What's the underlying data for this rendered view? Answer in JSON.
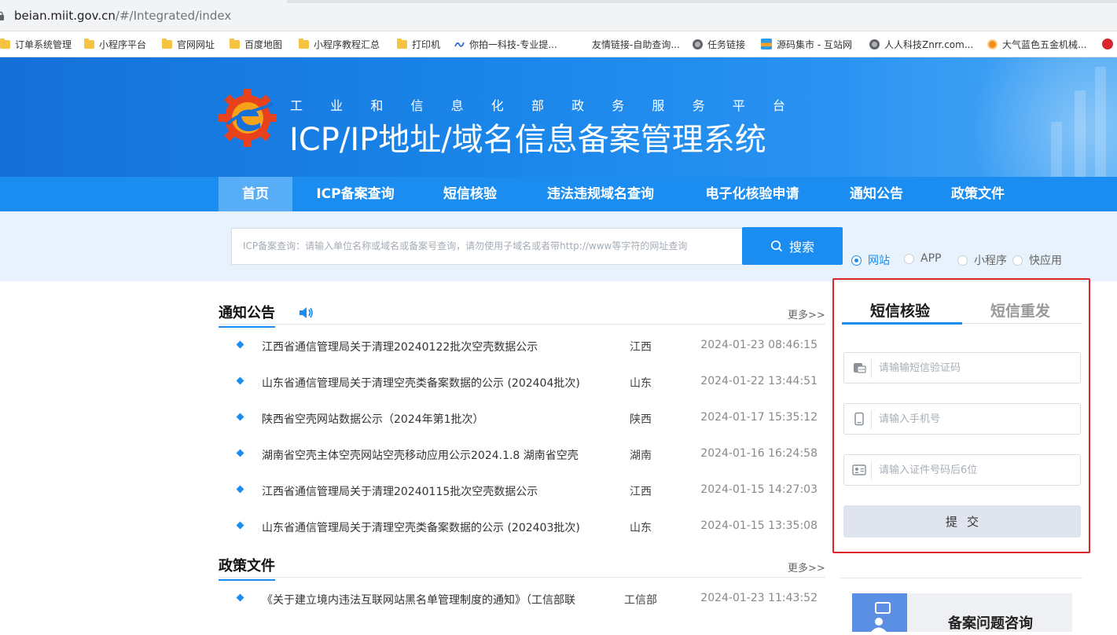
{
  "browser": {
    "url_host": "beian.miit.gov.cn",
    "url_path": "/#/Integrated/index"
  },
  "bookmarks": [
    {
      "label": "订单系统管理",
      "icon": "folder-icon"
    },
    {
      "label": "小程序平台",
      "icon": "folder-icon"
    },
    {
      "label": "官网网址",
      "icon": "folder-icon"
    },
    {
      "label": "百度地图",
      "icon": "folder-icon"
    },
    {
      "label": "小程序教程汇总",
      "icon": "folder-icon"
    },
    {
      "label": "打印机",
      "icon": "folder-icon"
    },
    {
      "label": "你拍一科技-专业提...",
      "icon": "wave-icon"
    },
    {
      "label": "友情链接-自助查询...",
      "icon": "none"
    },
    {
      "label": "任务链接",
      "icon": "globe-icon"
    },
    {
      "label": "源码集市 - 互站网",
      "icon": "source-icon"
    },
    {
      "label": "人人科技Znrr.com...",
      "icon": "globe-icon"
    },
    {
      "label": "大气蓝色五金机械...",
      "icon": "orange-icon"
    }
  ],
  "banner": {
    "subtitle_chars": [
      "工",
      "业",
      "和",
      "信",
      "息",
      "化",
      "部",
      "政",
      "务",
      "服",
      "务",
      "平",
      "台"
    ],
    "title": "ICP/IP地址/域名信息备案管理系统"
  },
  "nav": [
    {
      "label": "首页",
      "active": true
    },
    {
      "label": "ICP备案查询",
      "active": false
    },
    {
      "label": "短信核验",
      "active": false
    },
    {
      "label": "违法违规域名查询",
      "active": false
    },
    {
      "label": "电子化核验申请",
      "active": false
    },
    {
      "label": "通知公告",
      "active": false
    },
    {
      "label": "政策文件",
      "active": false
    }
  ],
  "search": {
    "placeholder": "ICP备案查询：请输入单位名称或域名或备案号查询，请勿使用子域名或者带http://www等字符的网址查询",
    "button_label": "搜索",
    "options": [
      {
        "label": "网站",
        "checked": true
      },
      {
        "label": "APP",
        "checked": false
      },
      {
        "label": "小程序",
        "checked": false
      },
      {
        "label": "快应用",
        "checked": false
      }
    ]
  },
  "notices": {
    "title": "通知公告",
    "more": "更多>>",
    "rows": [
      {
        "title": "江西省通信管理局关于清理20240122批次空壳数据公示",
        "region": "江西",
        "date": "2024-01-23 08:46:15"
      },
      {
        "title": "山东省通信管理局关于清理空壳类备案数据的公示 (202404批次)",
        "region": "山东",
        "date": "2024-01-22 13:44:51"
      },
      {
        "title": "陕西省空壳网站数据公示（2024年第1批次）",
        "region": "陕西",
        "date": "2024-01-17 15:35:12"
      },
      {
        "title": "湖南省空壳主体空壳网站空壳移动应用公示2024.1.8 湖南省空壳",
        "region": "湖南",
        "date": "2024-01-16 16:24:58"
      },
      {
        "title": "江西省通信管理局关于清理20240115批次空壳数据公示",
        "region": "江西",
        "date": "2024-01-15 14:27:03"
      },
      {
        "title": "山东省通信管理局关于清理空壳类备案数据的公示 (202403批次)",
        "region": "山东",
        "date": "2024-01-15 13:35:08"
      }
    ]
  },
  "policies": {
    "title": "政策文件",
    "more": "更多>>",
    "rows": [
      {
        "title": "《关于建立境内违法互联网站黑名单管理制度的通知》（工信部联",
        "region": "工信部",
        "date": "2024-01-23 11:43:52"
      }
    ]
  },
  "sms": {
    "tab_verify": "短信核验",
    "tab_resend": "短信重发",
    "code_placeholder": "请输输短信验证码",
    "phone_placeholder": "请输入手机号",
    "id_placeholder": "请输入证件号码后6位",
    "submit_label": "提交"
  },
  "help": {
    "label": "备案问题咨询"
  },
  "colors": {
    "primary": "#1b8cf0",
    "highlight_border": "#e0242b"
  }
}
